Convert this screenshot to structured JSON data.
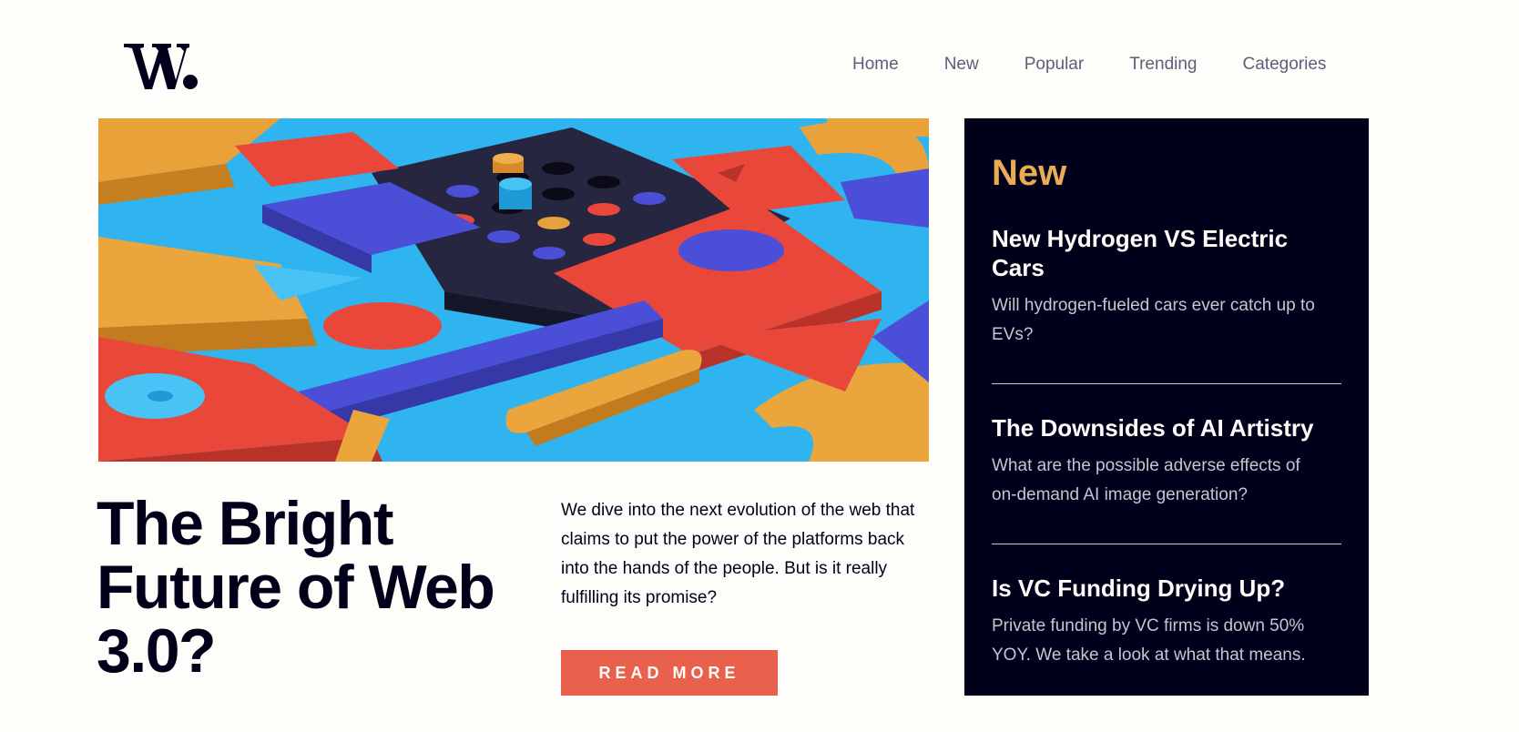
{
  "brand": {
    "logo_text": "W."
  },
  "nav": {
    "items": [
      "Home",
      "New",
      "Popular",
      "Trending",
      "Categories"
    ]
  },
  "hero": {
    "image_icon": "abstract-3d-shapes-image"
  },
  "main": {
    "headline": "The Bright Future of Web 3.0?",
    "intro": "We dive into the next evolution of the web that claims to put the power of the platforms back into the hands of the people. But is it really fulfilling its promise?",
    "read_more_label": "READ MORE"
  },
  "sidebar": {
    "title": "New",
    "items": [
      {
        "title": "New Hydrogen VS Electric Cars",
        "description": "Will hydrogen-fueled cars ever catch up to EVs?"
      },
      {
        "title": "The Downsides of AI Artistry",
        "description": "What are the possible adverse effects of on-demand AI image generation?"
      },
      {
        "title": "Is VC Funding Drying Up?",
        "description": "Private funding by VC firms is down 50% YOY. We take a look at what that means."
      }
    ]
  },
  "colors": {
    "background": "#fffdfa",
    "dark_navy": "#00001a",
    "accent_red": "#e9604d",
    "accent_orange": "#e9ab53",
    "grayish_blue": "#5d5f79",
    "light_gray": "#c5c6ce"
  }
}
